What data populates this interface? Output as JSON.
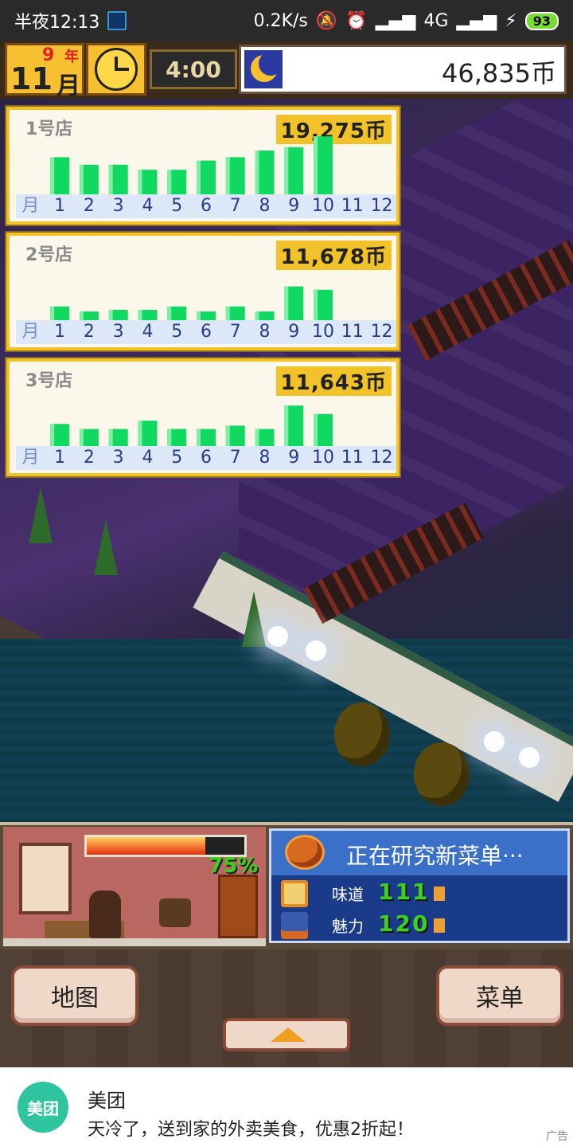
{
  "status_bar": {
    "time": "半夜12:13",
    "network_speed": "0.2K/s",
    "network_type": "4G",
    "battery": "93"
  },
  "hud": {
    "year_number": "9",
    "year_label": "年",
    "month_number": "11",
    "month_label": "月",
    "time": "4:00",
    "money": "46,835币",
    "icons": [
      "clock-icon",
      "moon-icon"
    ]
  },
  "stores": [
    {
      "name": "1号店",
      "total": "19,275币"
    },
    {
      "name": "2号店",
      "total": "11,678币"
    },
    {
      "name": "3号店",
      "total": "11,643币"
    }
  ],
  "month_axis": [
    "月",
    "1",
    "2",
    "3",
    "4",
    "5",
    "6",
    "7",
    "8",
    "9",
    "10",
    "11",
    "12"
  ],
  "chart_data": [
    {
      "type": "bar",
      "title": "1号店",
      "categories": [
        "1",
        "2",
        "3",
        "4",
        "5",
        "6",
        "7",
        "8",
        "9",
        "10",
        "11",
        "12"
      ],
      "values": [
        52,
        43,
        43,
        37,
        37,
        48,
        52,
        60,
        64,
        77,
        null,
        null
      ],
      "color": "#10d860"
    },
    {
      "type": "bar",
      "title": "2号店",
      "categories": [
        "1",
        "2",
        "3",
        "4",
        "5",
        "6",
        "7",
        "8",
        "9",
        "10",
        "11",
        "12"
      ],
      "values": [
        24,
        18,
        20,
        20,
        24,
        18,
        24,
        18,
        48,
        44,
        null,
        null
      ],
      "color": "#10d860"
    },
    {
      "type": "bar",
      "title": "3号店",
      "categories": [
        "1",
        "2",
        "3",
        "4",
        "5",
        "6",
        "7",
        "8",
        "9",
        "10",
        "11",
        "12"
      ],
      "values": [
        34,
        28,
        28,
        38,
        28,
        28,
        32,
        28,
        56,
        46,
        null,
        null
      ],
      "color": "#10d860"
    }
  ],
  "kitchen": {
    "progress_percent": 75,
    "progress_text": "75%"
  },
  "research": {
    "title": "正在研究新菜单···",
    "stats": [
      {
        "label": "味道",
        "value": "111",
        "icon": "taste-icon"
      },
      {
        "label": "魅力",
        "value": "120",
        "icon": "charm-icon"
      }
    ]
  },
  "buttons": {
    "map": "地图",
    "menu": "菜单"
  },
  "ad": {
    "logo": "美团",
    "title": "美团",
    "description": "天冷了，送到家的外卖美食，优惠2折起！",
    "tag": "广告"
  }
}
